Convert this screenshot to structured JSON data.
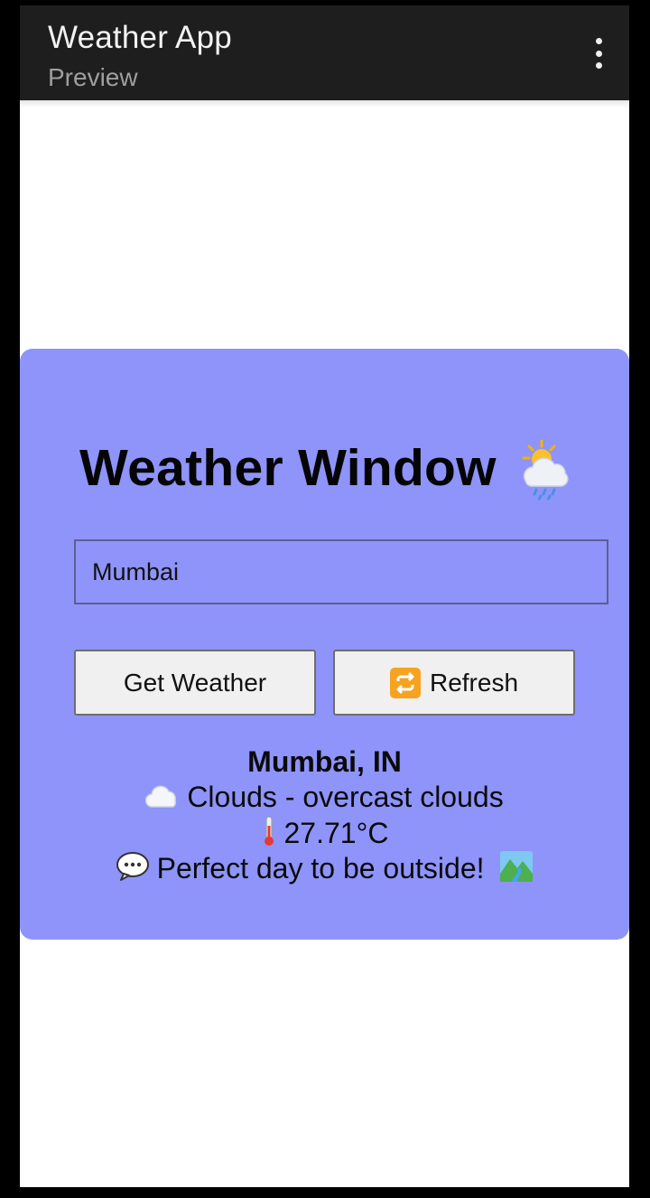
{
  "appbar": {
    "title": "Weather App",
    "subtitle": "Preview",
    "menu_icon": "more-vert-icon"
  },
  "card": {
    "title": "Weather Window",
    "title_icon": "sun-behind-rain-cloud-icon",
    "background_color": "#8e94fa"
  },
  "search": {
    "value": "Mumbai"
  },
  "buttons": {
    "get_weather_label": "Get Weather",
    "refresh_label": "Refresh",
    "refresh_icon": "repeat-arrows-icon"
  },
  "result": {
    "city": "Mumbai, IN",
    "condition": "Clouds - overcast clouds",
    "condition_icon": "cloud-icon",
    "temperature": "27.71°C",
    "temperature_icon": "thermometer-icon",
    "message": "Perfect day to be outside!",
    "message_icon": "speech-bubble-icon",
    "message_trailing_icon": "landscape-icon"
  }
}
